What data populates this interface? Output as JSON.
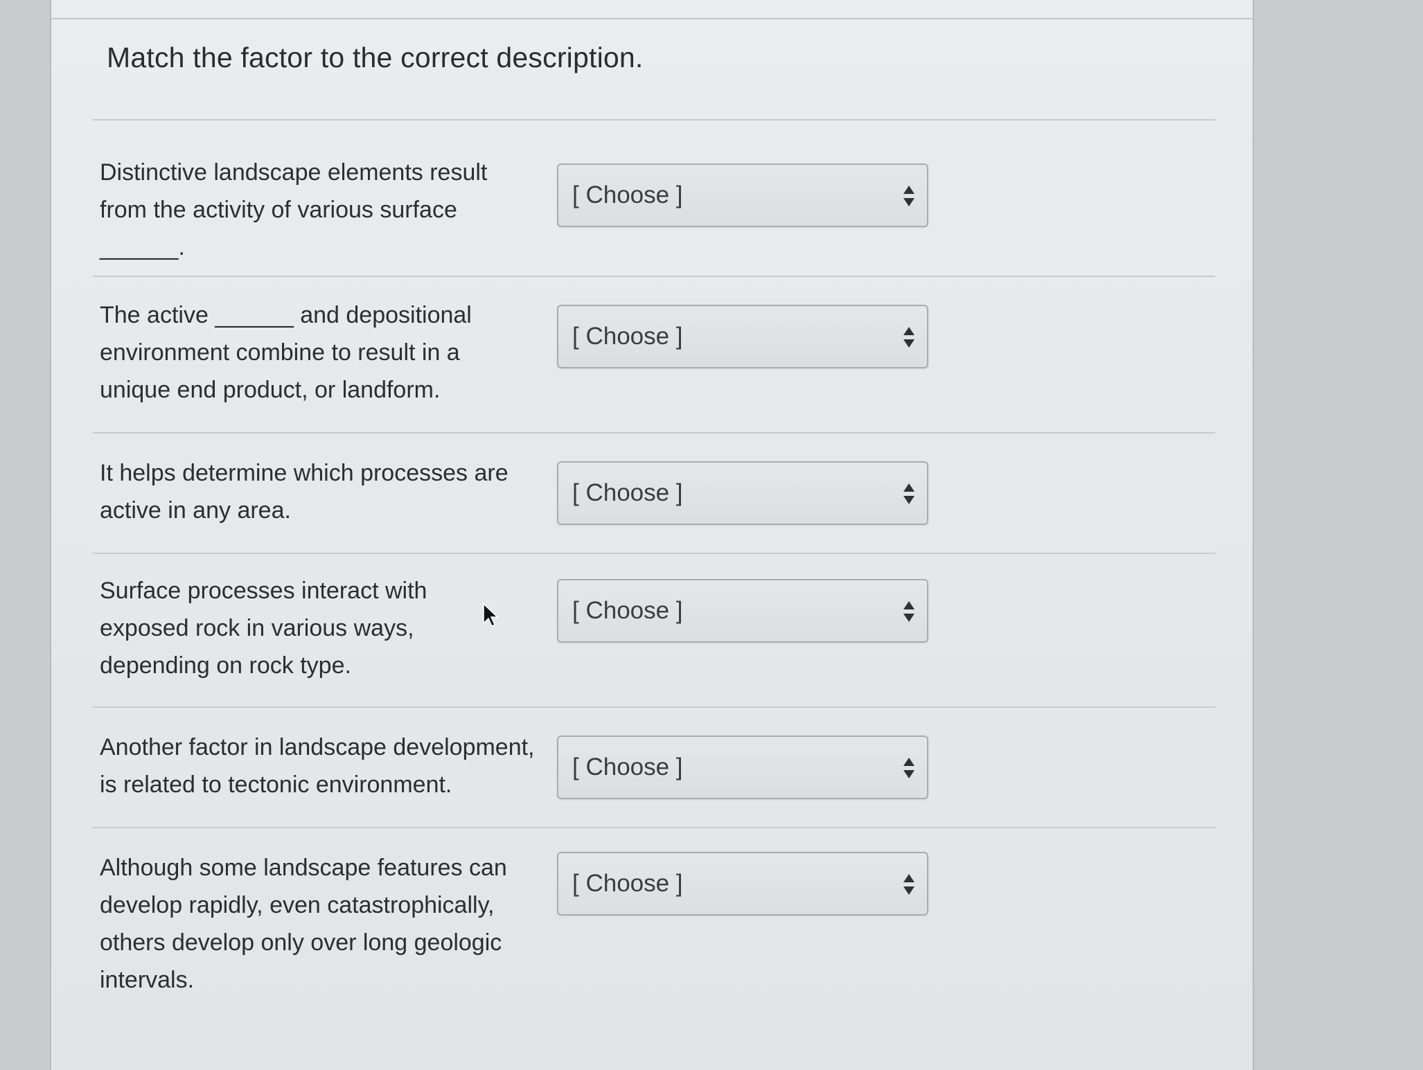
{
  "question": {
    "title": "Match the factor to the correct description."
  },
  "rows": [
    {
      "prompt": "Distinctive landscape elements result from the activity of various surface ______.",
      "select_value": "[ Choose ]"
    },
    {
      "prompt": "The active ______ and depositional environment combine to result in a unique end product, or landform.",
      "select_value": "[ Choose ]"
    },
    {
      "prompt": "It helps determine which processes are active in any area.",
      "select_value": "[ Choose ]"
    },
    {
      "prompt": "Surface processes interact with exposed rock in various ways, depending on rock type.",
      "select_value": "[ Choose ]"
    },
    {
      "prompt": "Another factor in landscape development, is related to tectonic environment.",
      "select_value": "[ Choose ]"
    },
    {
      "prompt": "Although some landscape features can develop rapidly, even catastrophically, others develop only over long geologic intervals.",
      "select_value": "[ Choose ]"
    }
  ],
  "icons": {
    "select_arrows": "sort-up-down-icon",
    "cursor": "mouse-pointer-icon"
  },
  "colors": {
    "page_background": "#e6e8ea",
    "text": "#2b2d2f",
    "select_border": "#a9abad"
  }
}
